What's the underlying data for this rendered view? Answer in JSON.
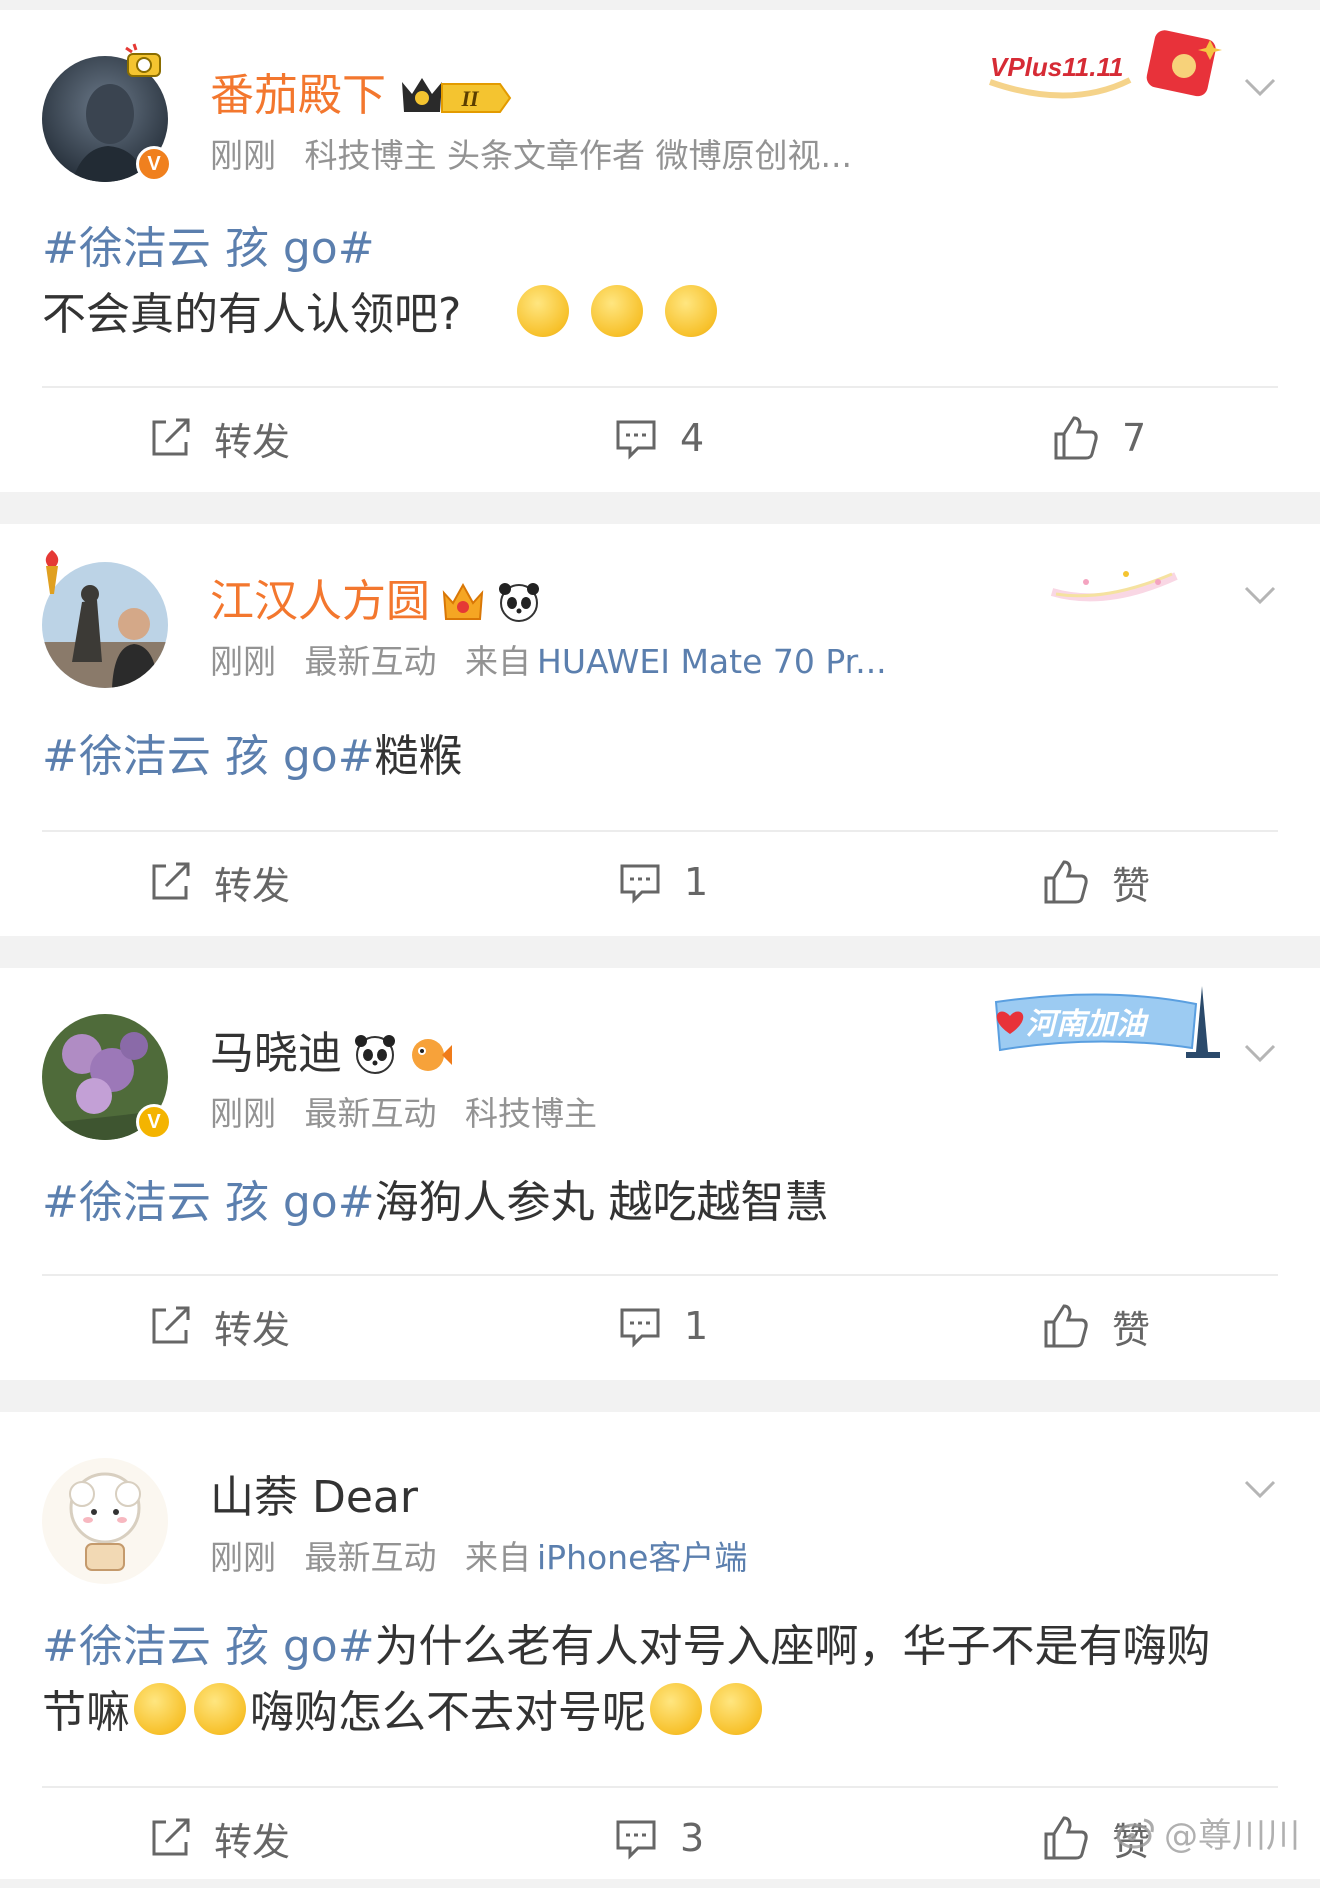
{
  "posts": [
    {
      "username": "番茄殿下",
      "meta": [
        "刚刚",
        "科技博主 头条文章作者 微博原创视..."
      ],
      "hashtag": "#徐洁云 孩 go#",
      "text_after_tag": "",
      "second_line": "不会真的有人认领吧?",
      "repost_label": "转发",
      "comment_count": "4",
      "like_label": "7",
      "decor_text": "VPlus11.11",
      "name_badge": "II"
    },
    {
      "username": "江汉人方圆",
      "meta": [
        "刚刚",
        "最新互动",
        "来自",
        "HUAWEI Mate 70 Pr..."
      ],
      "hashtag": "#徐洁云 孩 go#",
      "text_after_tag": "糙糇",
      "repost_label": "转发",
      "comment_count": "1",
      "like_label": "赞"
    },
    {
      "username": "马晓迪",
      "meta": [
        "刚刚",
        "最新互动",
        "科技博主"
      ],
      "hashtag": "#徐洁云 孩 go#",
      "text_after_tag": "海狗人参丸 越吃越智慧",
      "repost_label": "转发",
      "comment_count": "1",
      "like_label": "赞",
      "decor_text": "河南加油"
    },
    {
      "username": "山萘 Dear",
      "meta": [
        "刚刚",
        "最新互动",
        "来自",
        "iPhone客户端"
      ],
      "hashtag": "#徐洁云 孩 go#",
      "text_after_tag": "为什么老有人对号入座啊，华子不是有嗨购",
      "line2_a": "节嘛",
      "line2_b": "嗨购怎么不去对号呢",
      "repost_label": "转发",
      "comment_count": "3",
      "like_label": "赞"
    }
  ],
  "watermark": "@尊川川",
  "colors": {
    "vip_name": "#f3772e",
    "link": "#5b7fae",
    "meta": "#939393",
    "badge_orange": "#f0801e",
    "badge_yellow": "#f4b400"
  },
  "icons": [
    "repost-icon",
    "comment-icon",
    "like-icon",
    "chevron-down-icon",
    "verified-badge-icon"
  ]
}
